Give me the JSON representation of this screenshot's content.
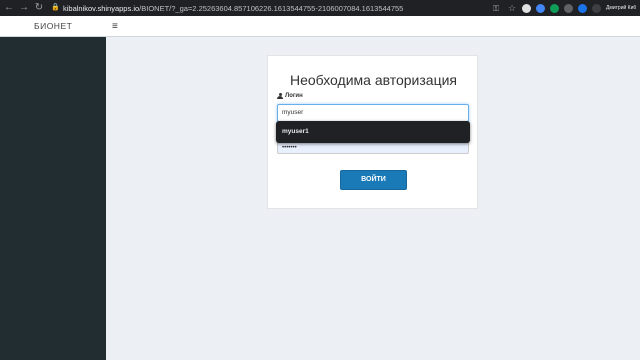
{
  "browser": {
    "back_icon": "arrow-left-icon",
    "forward_icon": "arrow-right-icon",
    "reload_icon": "reload-icon",
    "lock_icon": "lock-icon",
    "url_host": "kibalnikov.shinyapps.io",
    "url_path": "/BIONET/?_ga=2.25263604.857106226.1613544755-2106007084.1613544755",
    "profile_name": "Дмитрий Кибальников"
  },
  "header": {
    "logo": "БИОНЕТ",
    "menu_icon": "≡"
  },
  "login": {
    "title": "Необходима авторизация",
    "login_label": "Логин",
    "username_value": "myuser",
    "password_value": "•••••••",
    "autofill_suggestion": "myuser1",
    "submit_label": "ВОЙТИ"
  },
  "colors": {
    "sidebar": "#222d32",
    "content_bg": "#ecf0f5",
    "button": "#1a7ab7",
    "autofill_bg": "#202124"
  }
}
